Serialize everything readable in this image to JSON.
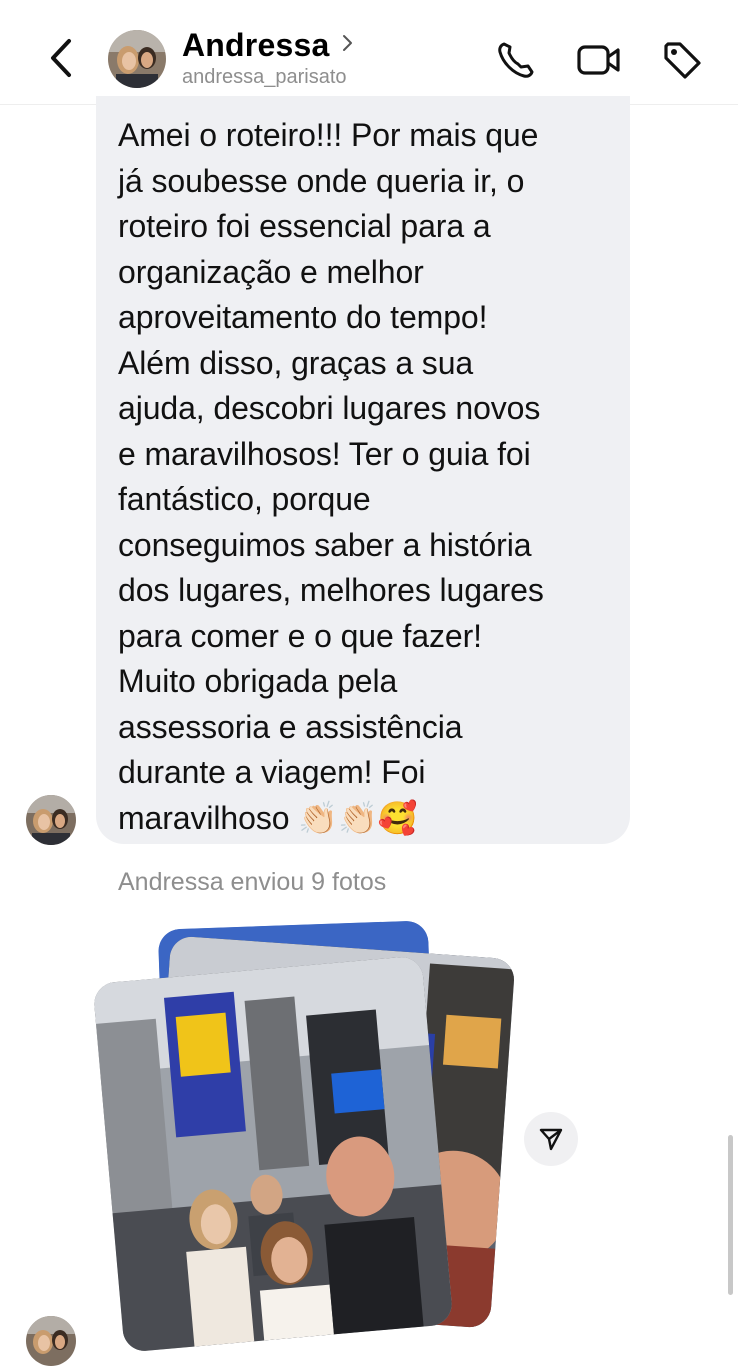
{
  "header": {
    "contact_name": "Andressa",
    "contact_handle": "andressa_parisato",
    "icons": [
      "back-chevron-icon",
      "profile-chevron-icon",
      "phone-icon",
      "video-camera-icon",
      "tag-icon"
    ]
  },
  "message": {
    "text": "Amei o roteiro!!! Por mais que\njá soubesse onde queria ir, o\nroteiro foi essencial para a\norganização e melhor\naproveitamento do tempo!\nAlém disso, graças a sua\najuda, descobri lugares novos\ne maravilhosos! Ter o guia foi\nfantástico, porque\nconseguimos saber a história\ndos lugares, melhores lugares\npara comer e o que fazer!\nMuito obrigada pela\nassessoria e assistência\ndurante a viagem! Foi\nmaravilhoso 👏🏻👏🏻🥰",
    "bubble_color": "#eff0f3"
  },
  "photos": {
    "label": "Andressa enviou 9 fotos",
    "share_icon": "send-arrow-icon"
  },
  "colors": {
    "secondary_text": "#8e8e8e",
    "background": "#ffffff"
  }
}
